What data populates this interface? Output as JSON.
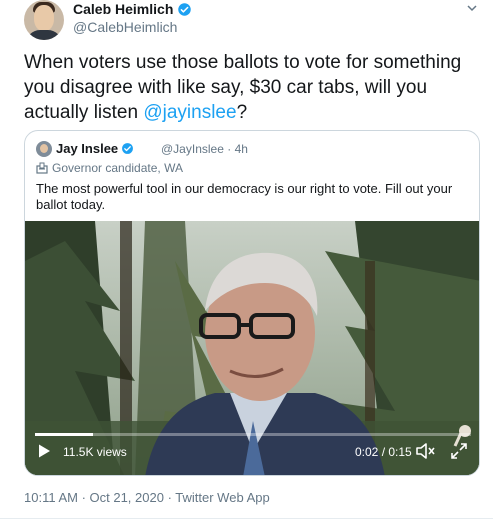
{
  "author": {
    "name": "Caleb Heimlich",
    "handle": "@CalebHeimlich",
    "verified_icon": "verified-badge"
  },
  "tweet": {
    "text_before": "When voters use those ballots to vote for something you disagree with like say, $30 car tabs, will you actually listen ",
    "mention": "@jayinslee",
    "text_after": "?"
  },
  "quote": {
    "name": "Jay Inslee",
    "handle": "@JayInslee",
    "age": "· 4h",
    "label": "Governor candidate, WA",
    "text": "The most powerful tool in our democracy is our right to vote. Fill out your ballot today.",
    "video": {
      "views": "11.5K views",
      "time": "0:02 / 0:15",
      "progress": 0.133
    }
  },
  "meta": {
    "timestamp": "10:11 AM · Oct 21, 2020",
    "separator": " · ",
    "source": "Twitter Web App"
  },
  "colors": {
    "link": "#1da1f2",
    "secondary": "#657786"
  }
}
